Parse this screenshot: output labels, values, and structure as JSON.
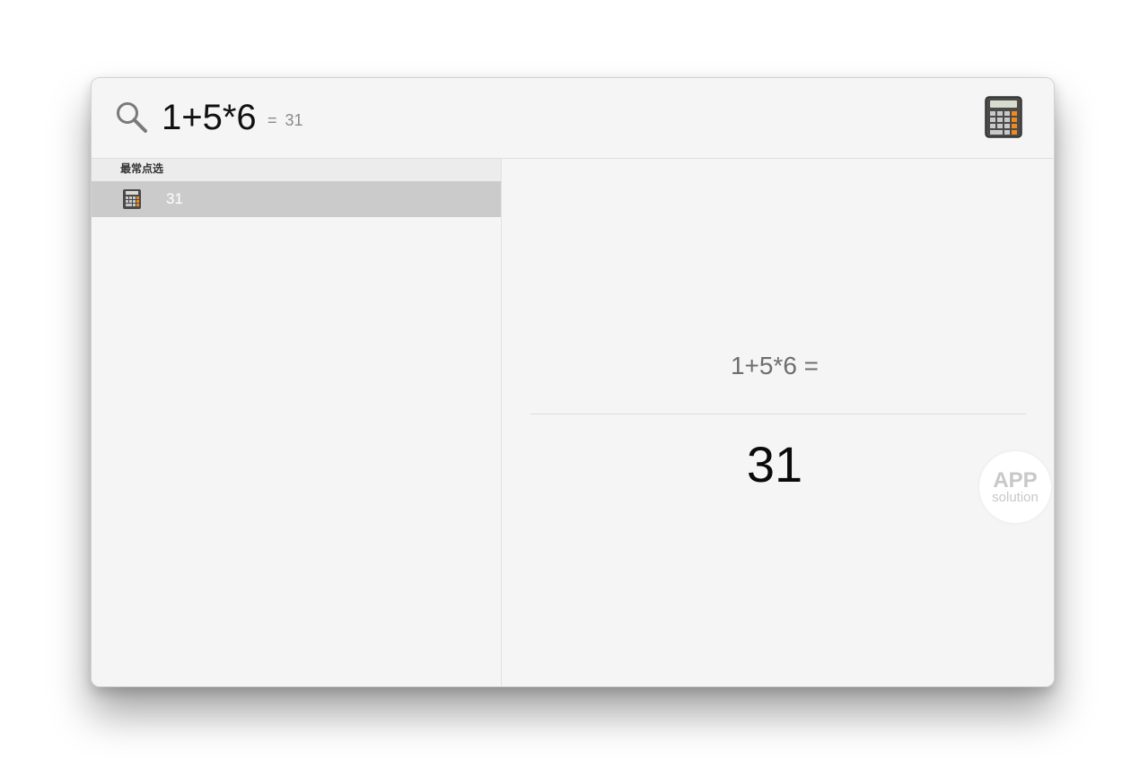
{
  "search": {
    "query": "1+5*6",
    "inline_equals": "=",
    "inline_result": "31",
    "app_icon": "calculator-icon"
  },
  "sidebar": {
    "section_title": "最常点选",
    "results": [
      {
        "icon": "calculator-icon",
        "label": "31",
        "selected": true
      }
    ]
  },
  "preview": {
    "expression": "1+5*6 =",
    "answer": "31"
  },
  "watermark": {
    "line1": "APP",
    "line2": "solution"
  },
  "colors": {
    "window_bg": "#f5f5f5",
    "selected_row": "#cbcbcb",
    "calculator_orange": "#f08a1c"
  }
}
